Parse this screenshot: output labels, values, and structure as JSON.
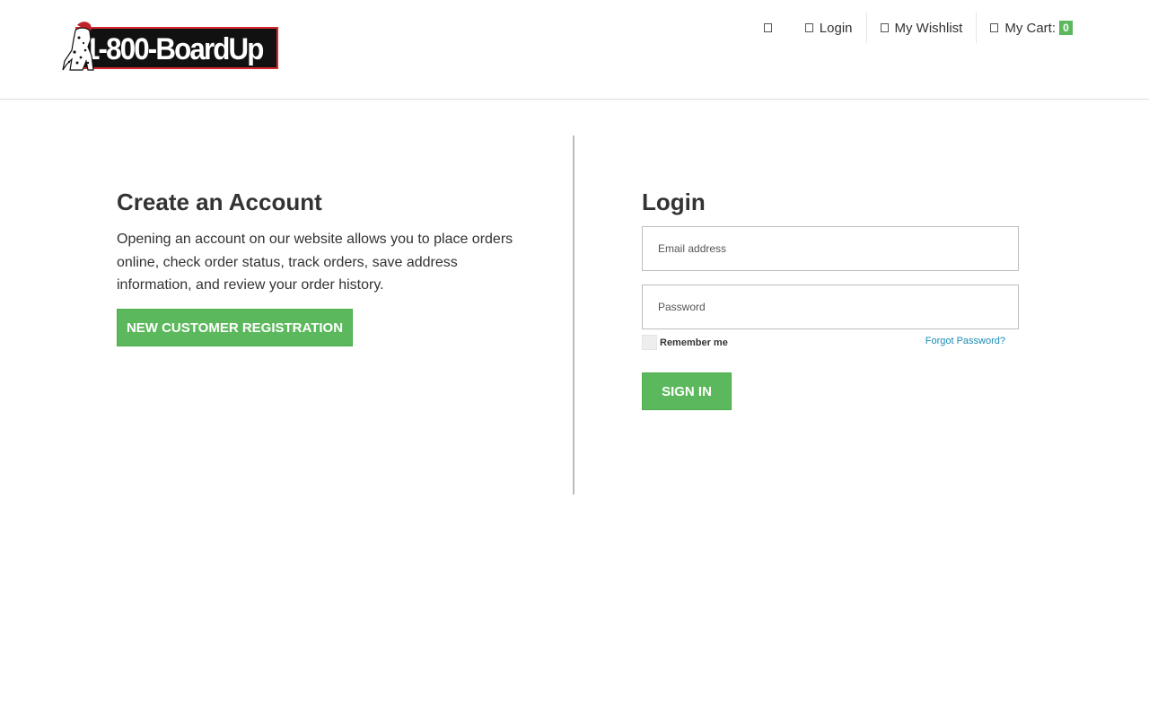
{
  "header": {
    "logo_text": "1-800-BoardUp",
    "links": {
      "search_label": "",
      "login_label": "Login",
      "wishlist_label": "My Wishlist",
      "cart_label": "My Cart:",
      "cart_count": "0"
    }
  },
  "create_account": {
    "title": "Create an Account",
    "description": "Opening an account on our website allows you to place orders online, check order status, track orders, save address information, and review your order history.",
    "register_button": "NEW CUSTOMER REGISTRATION"
  },
  "login": {
    "title": "Login",
    "email_placeholder": "Email address",
    "password_placeholder": "Password",
    "remember_label": "Remember me",
    "forgot_label": "Forgot Password?",
    "signin_button": "SIGN IN"
  },
  "colors": {
    "accent_green": "#5cb85c",
    "link_blue": "#1a8bb3",
    "logo_red": "#d8262f"
  }
}
